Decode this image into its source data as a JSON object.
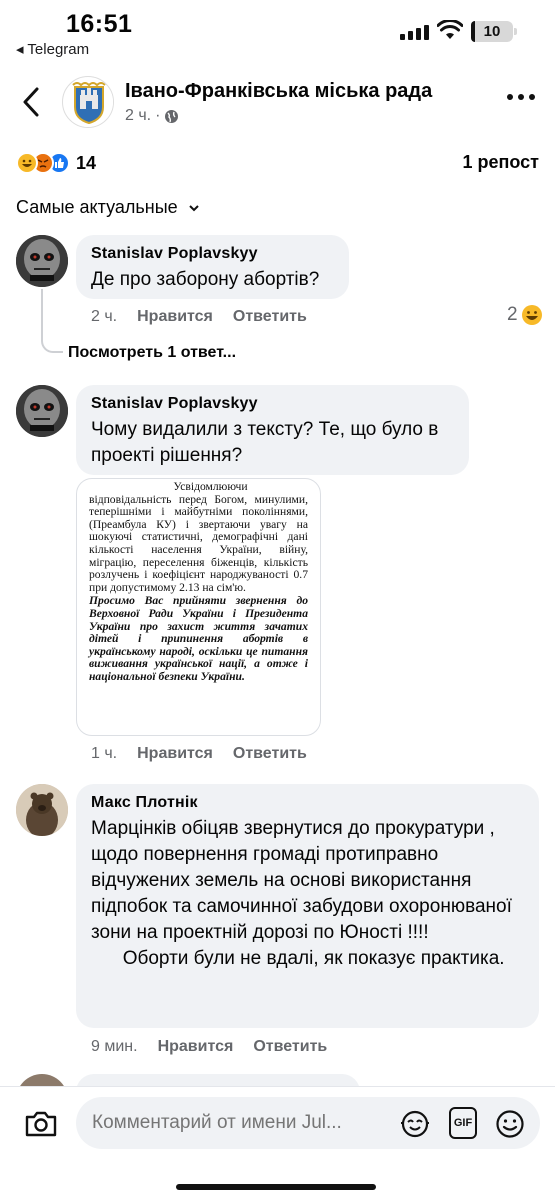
{
  "status": {
    "time": "16:51",
    "back_app": "◂ Telegram",
    "battery": "10",
    "battery_level": 0.1
  },
  "header": {
    "page_name": "Івано-Франківська міська рада",
    "post_age": "2 ч.",
    "dot": "·"
  },
  "reactions": {
    "count": "14",
    "reposts": "1 репост",
    "types": [
      "haha",
      "angry",
      "like"
    ]
  },
  "sort": {
    "label": "Самые актуальные"
  },
  "comments": [
    {
      "author": "Stanislav Poplavskyy",
      "text": "Де про заборону абортів?",
      "time": "2 ч.",
      "like_label": "Нравится",
      "reply_label": "Ответить",
      "reaction_count": "2",
      "view_replies": "Посмотреть 1 ответ..."
    },
    {
      "author": "Stanislav Poplavskyy",
      "text": "Чому видалили з тексту? Те, що було в проекті рішення?",
      "time": "1 ч.",
      "like_label": "Нравится",
      "reply_label": "Ответить",
      "attachment": {
        "line0": "Усвідомлюючи",
        "para1": "відповідальність перед Богом, минулими, теперішніми і майбутніми поколіннями, (Преамбула КУ) і звертаючи увагу на шокуючі статистичні, демографічні дані кількості населення України, війну, міграцію, переселення біженців, кількість розлучень і коефіцієнт народжуваності 0.7 при допустимому 2.13 на сім'ю.",
        "para2": "Просимо Вас прийняти звернення до Верховної Ради України і Президента України про захист життя зачатих дітей і припинення абортів в українському народі, оскільки це питання виживання української нації, а отже і національної безпеки України."
      }
    },
    {
      "author": "Макс Плотнік",
      "text": "Марцінків обіцяв звернутися до прокуратури , щодо повернення громаді протиправно відчужених земель на основі використання підпобок та самочинної забудови охоронюваної зони на проектній дорозі по Юності !!!!\n      Оборти були не вдалі, як показує практика.",
      "time": "9 мин.",
      "like_label": "Нравится",
      "reply_label": "Ответить"
    }
  ],
  "composer": {
    "placeholder": "Комментарий от имени Jul...",
    "gif_label": "GIF"
  }
}
